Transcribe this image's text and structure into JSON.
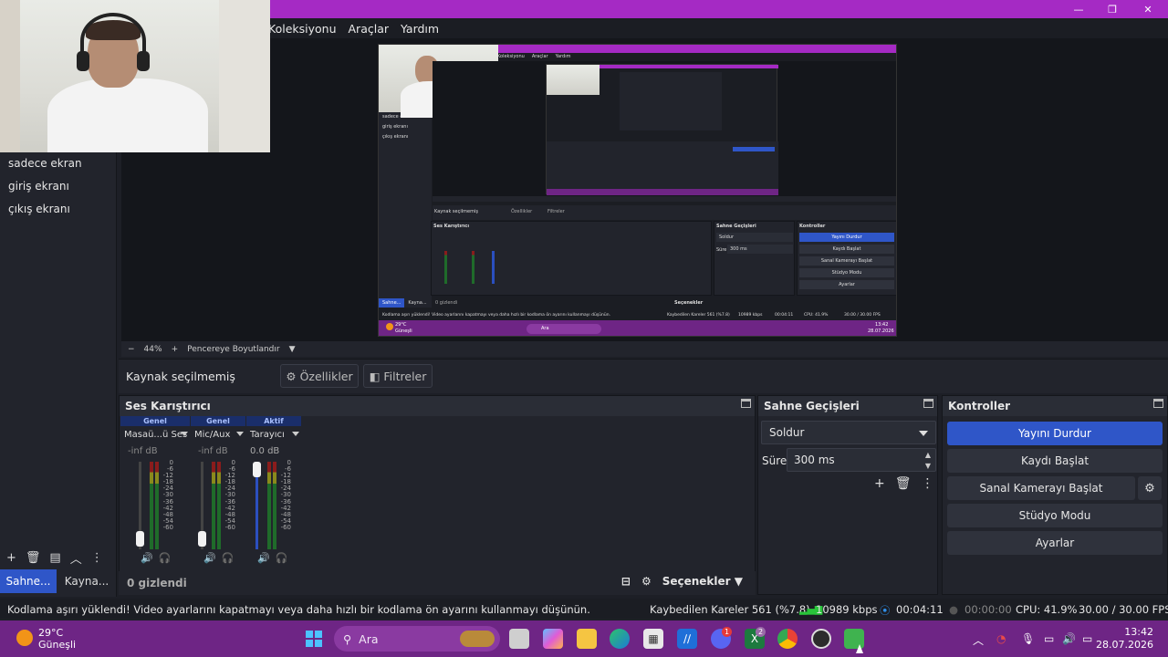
{
  "menu": {
    "items": [
      "Koleksiyonu",
      "Araçlar",
      "Yardım"
    ]
  },
  "scenes": {
    "items": [
      "sadece ekran",
      "giriş ekranı",
      "çıkış ekranı"
    ],
    "tabs": [
      "Sahne...",
      "Kayna..."
    ]
  },
  "preview": {
    "zoom": "44%",
    "fit_label": "Pencereye Boyutlandır",
    "nested_menu": [
      "Koleksiyonu",
      "Araçlar",
      "Yardım"
    ],
    "nested_scenes": [
      "sadece ekran",
      "giriş ekranı",
      "çıkış ekranı"
    ],
    "nested_source_label": "Kaynak seçilmemiş",
    "nested_props": "Özellikler",
    "nested_filters": "Filtreler",
    "nested_mixer": "Ses Karıştırıcı",
    "nested_trans": "Sahne Geçişleri",
    "nested_ctrl": "Kontroller",
    "nested_trans_value": "Soldur",
    "nested_dur_label": "Süre",
    "nested_dur_value": "300 ms",
    "nested_buttons": [
      "Yayını Durdur",
      "Kaydı Başlat",
      "Sanal Kamerayı Başlat",
      "Stüdyo Modu",
      "Ayarlar"
    ],
    "nested_tabs": [
      "Sahne...",
      "Kayna..."
    ],
    "nested_hidden": "0 gizlendi",
    "nested_options": "Seçenekler",
    "nested_status": "Kodlama aşırı yüklendi! Video ayarlarını kapatmayı veya daha hızlı bir kodlama ön ayarını kullanmayı düşünün.",
    "nested_dropped": "Kaybedilen Kareler 561 (%7.8)",
    "nested_kbps": "10989 kbps",
    "nested_time": "00:04:11",
    "nested_cpu": "CPU: 41.9%",
    "nested_fps": "30.00 / 30.00 FPS",
    "nested_search": "Ara",
    "nested_temp": "29°C",
    "nested_weather": "Güneşli",
    "nested_clock_time": "13:42",
    "nested_clock_date": "28.07.2026"
  },
  "source": {
    "label": "Kaynak seçilmemiş",
    "properties": "Özellikler",
    "filters": "Filtreler"
  },
  "mixer": {
    "title": "Ses Karıştırıcı",
    "channels": [
      {
        "tag": "Genel",
        "name": "Masaü...ü Ses",
        "db": "-inf dB"
      },
      {
        "tag": "Genel",
        "name": "Mic/Aux",
        "db": "-inf dB"
      },
      {
        "tag": "Aktif",
        "name": "Tarayıcı",
        "db": "0.0 dB"
      }
    ],
    "scale": [
      "0",
      "-6",
      "-12",
      "-18",
      "-24",
      "-30",
      "-36",
      "-42",
      "-48",
      "-54",
      "-60"
    ],
    "hidden": "0 gizlendi",
    "options": "Seçenekler"
  },
  "transitions": {
    "title": "Sahne Geçişleri",
    "selected": "Soldur",
    "duration_label": "Süre",
    "duration_value": "300 ms"
  },
  "controls": {
    "title": "Kontroller",
    "stop_stream": "Yayını Durdur",
    "start_record": "Kaydı Başlat",
    "virtual_cam": "Sanal Kamerayı Başlat",
    "studio_mode": "Stüdyo Modu",
    "settings": "Ayarlar"
  },
  "status": {
    "message": "Kodlama aşırı yüklendi! Video ayarlarını kapatmayı veya daha hızlı bir kodlama ön ayarını kullanmayı düşünün.",
    "dropped": "Kaybedilen Kareler 561 (%7.8)",
    "bitrate": "10989 kbps",
    "stream_time": "00:04:11",
    "record_time": "00:00:00",
    "cpu": "CPU: 41.9%",
    "fps": "30.00 / 30.00 FPS"
  },
  "taskbar": {
    "temp": "29°C",
    "weather": "Güneşli",
    "search": "Ara",
    "time": "13:42",
    "date": "28.07.2026",
    "badge_discord": "1",
    "badge_excel": "2"
  },
  "colors": {
    "title_bar": "#a52ac4",
    "accent": "#2f56c8",
    "taskbar": "#6e2585",
    "bitrate_ok": "#29c43a"
  }
}
